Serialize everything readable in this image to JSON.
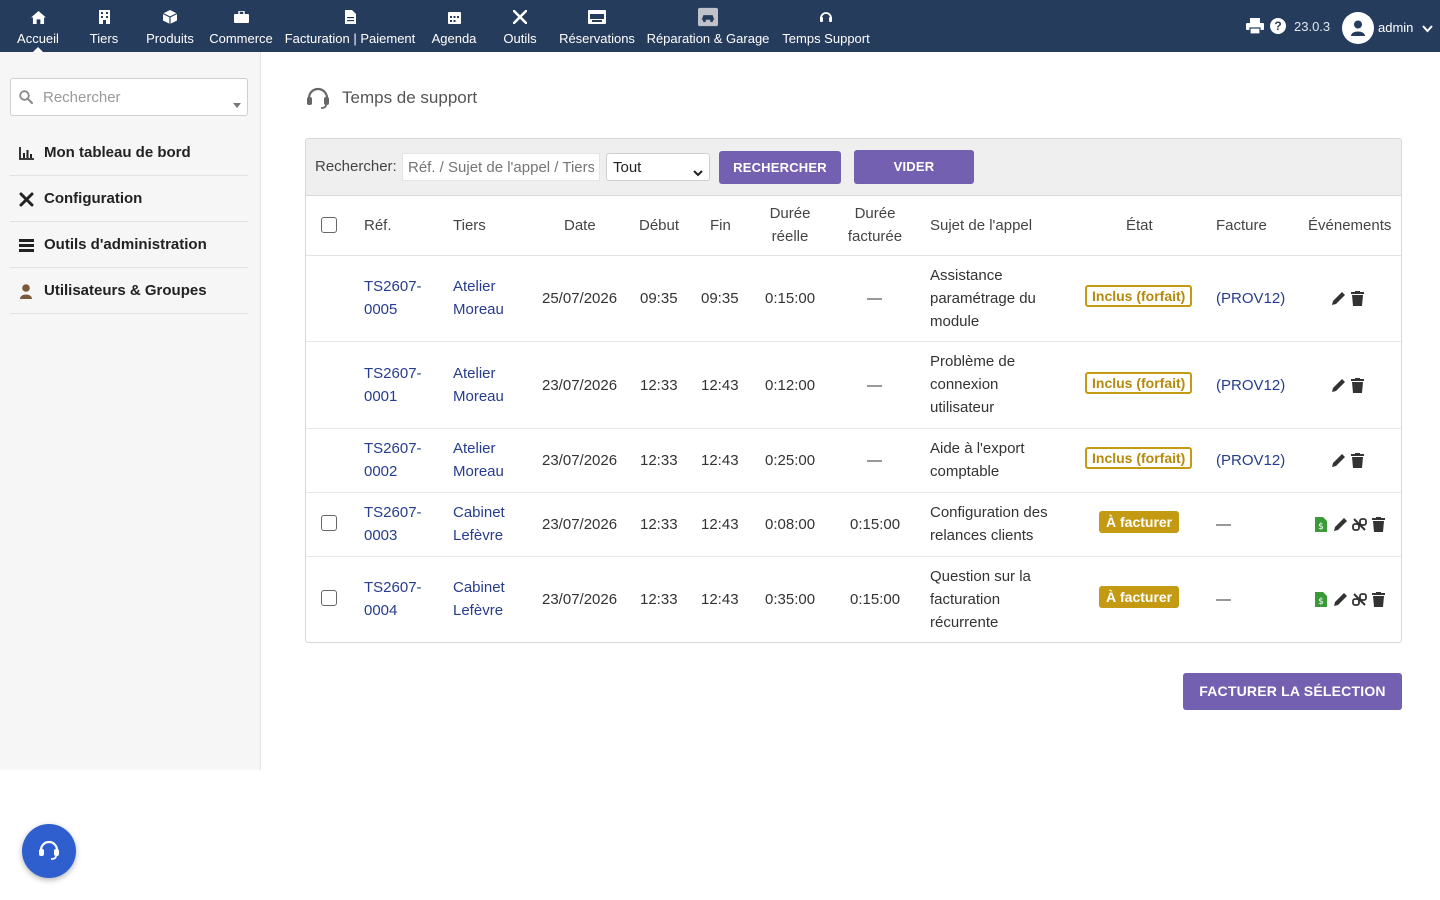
{
  "nav": {
    "items": [
      {
        "label": "Accueil",
        "icon": "home-icon"
      },
      {
        "label": "Tiers",
        "icon": "building-icon"
      },
      {
        "label": "Produits",
        "icon": "cube-icon"
      },
      {
        "label": "Commerce",
        "icon": "briefcase-icon"
      },
      {
        "label": "Facturation | Paiement",
        "icon": "invoice-icon"
      },
      {
        "label": "Agenda",
        "icon": "calendar-icon"
      },
      {
        "label": "Outils",
        "icon": "tools-icon"
      },
      {
        "label": "Réservations",
        "icon": "reservation-icon"
      },
      {
        "label": "Réparation & Garage",
        "icon": "car-icon"
      },
      {
        "label": "Temps Support",
        "icon": "headset-icon"
      }
    ],
    "version": "23.0.3",
    "user": "admin"
  },
  "sidebar": {
    "search_placeholder": "Rechercher",
    "items": [
      {
        "label": "Mon tableau de bord",
        "icon": "chart-icon"
      },
      {
        "label": "Configuration",
        "icon": "tools-icon"
      },
      {
        "label": "Outils d'administration",
        "icon": "server-icon"
      },
      {
        "label": "Utilisateurs & Groupes",
        "icon": "user-icon"
      }
    ]
  },
  "page": {
    "title": "Temps de support"
  },
  "filter": {
    "label": "Rechercher:",
    "placeholder": "Réf. / Sujet de l'appel / Tiers",
    "select_value": "Tout",
    "search_button": "RECHERCHER",
    "clear_button": "VIDER"
  },
  "table": {
    "headers": {
      "ref": "Réf.",
      "tiers": "Tiers",
      "date": "Date",
      "debut": "Début",
      "fin": "Fin",
      "duree_reelle_1": "Durée",
      "duree_reelle_2": "réelle",
      "duree_facturee_1": "Durée",
      "duree_facturee_2": "facturée",
      "sujet": "Sujet de l'appel",
      "etat": "État",
      "facture": "Facture",
      "evenements": "Événements"
    },
    "rows": [
      {
        "ref1": "TS2607-",
        "ref2": "0005",
        "tiers1": "Atelier",
        "tiers2": "Moreau",
        "date": "25/07/2026",
        "debut": "09:35",
        "fin": "09:35",
        "duree_reelle": "0:15:00",
        "duree_facturee": "—",
        "sujet": [
          "Assistance",
          "paramétrage du",
          "module"
        ],
        "etat": "Inclus (forfait)",
        "facture": "(PROV12)"
      },
      {
        "ref1": "TS2607-",
        "ref2": "0001",
        "tiers1": "Atelier",
        "tiers2": "Moreau",
        "date": "23/07/2026",
        "debut": "12:33",
        "fin": "12:43",
        "duree_reelle": "0:12:00",
        "duree_facturee": "—",
        "sujet": [
          "Problème de",
          "connexion",
          "utilisateur"
        ],
        "etat": "Inclus (forfait)",
        "facture": "(PROV12)"
      },
      {
        "ref1": "TS2607-",
        "ref2": "0002",
        "tiers1": "Atelier",
        "tiers2": "Moreau",
        "date": "23/07/2026",
        "debut": "12:33",
        "fin": "12:43",
        "duree_reelle": "0:25:00",
        "duree_facturee": "—",
        "sujet": [
          "Aide à l'export",
          "comptable"
        ],
        "etat": "Inclus (forfait)",
        "facture": "(PROV12)"
      },
      {
        "ref1": "TS2607-",
        "ref2": "0003",
        "tiers1": "Cabinet",
        "tiers2": "Lefèvre",
        "date": "23/07/2026",
        "debut": "12:33",
        "fin": "12:43",
        "duree_reelle": "0:08:00",
        "duree_facturee": "0:15:00",
        "sujet": [
          "Configuration des",
          "relances clients"
        ],
        "etat": "À facturer",
        "facture": "—"
      },
      {
        "ref1": "TS2607-",
        "ref2": "0004",
        "tiers1": "Cabinet",
        "tiers2": "Lefèvre",
        "date": "23/07/2026",
        "debut": "12:33",
        "fin": "12:43",
        "duree_reelle": "0:35:00",
        "duree_facturee": "0:15:00",
        "sujet": [
          "Question sur la",
          "facturation",
          "récurrente"
        ],
        "etat": "À facturer",
        "facture": "—"
      }
    ]
  },
  "bill_button": "FACTURER LA SÉLECTION",
  "colors": {
    "topbar": "#263c5c",
    "accent": "#7460b0",
    "badge": "#c49a12",
    "fab": "#2f5fcf"
  }
}
